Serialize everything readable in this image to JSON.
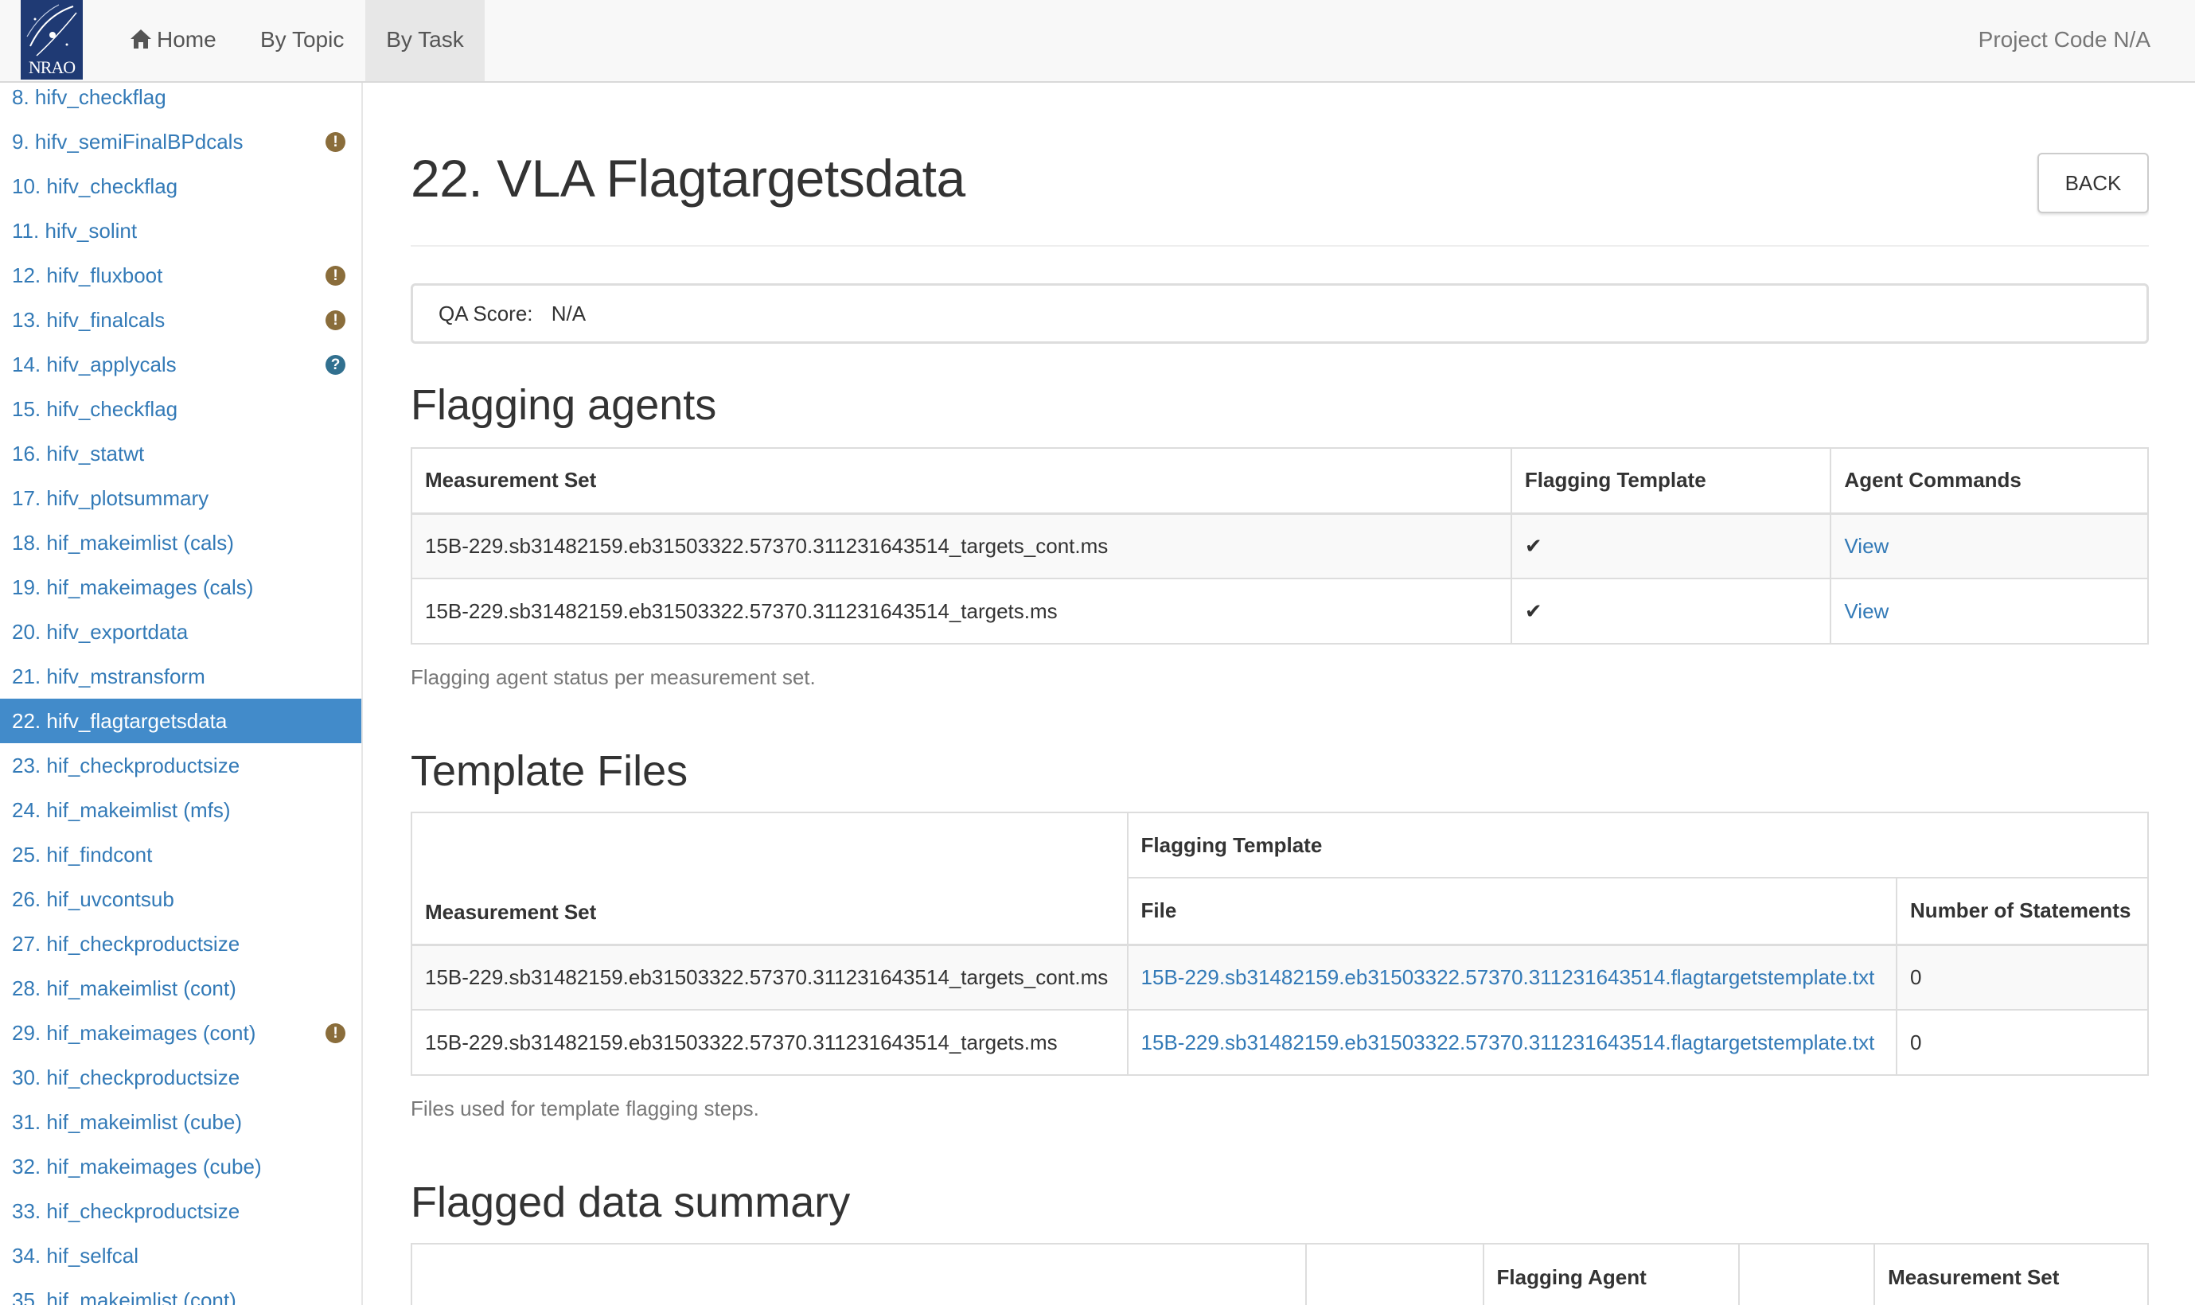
{
  "navbar": {
    "logo_text": "NRAO",
    "home_label": "Home",
    "by_topic_label": "By Topic",
    "by_task_label": "By Task",
    "project_code": "Project Code N/A"
  },
  "sidebar": {
    "items": [
      {
        "label": "8. hifv_checkflag",
        "qa": ""
      },
      {
        "label": "9. hifv_semiFinalBPdcals",
        "qa": "warning"
      },
      {
        "label": "10. hifv_checkflag",
        "qa": ""
      },
      {
        "label": "11. hifv_solint",
        "qa": ""
      },
      {
        "label": "12. hifv_fluxboot",
        "qa": "warning"
      },
      {
        "label": "13. hifv_finalcals",
        "qa": "warning"
      },
      {
        "label": "14. hifv_applycals",
        "qa": "info"
      },
      {
        "label": "15. hifv_checkflag",
        "qa": ""
      },
      {
        "label": "16. hifv_statwt",
        "qa": ""
      },
      {
        "label": "17. hifv_plotsummary",
        "qa": ""
      },
      {
        "label": "18. hif_makeimlist (cals)",
        "qa": ""
      },
      {
        "label": "19. hif_makeimages (cals)",
        "qa": ""
      },
      {
        "label": "20. hifv_exportdata",
        "qa": ""
      },
      {
        "label": "21. hifv_mstransform",
        "qa": ""
      },
      {
        "label": "22. hifv_flagtargetsdata",
        "qa": "",
        "active": true
      },
      {
        "label": "23. hif_checkproductsize",
        "qa": ""
      },
      {
        "label": "24. hif_makeimlist (mfs)",
        "qa": ""
      },
      {
        "label": "25. hif_findcont",
        "qa": ""
      },
      {
        "label": "26. hif_uvcontsub",
        "qa": ""
      },
      {
        "label": "27. hif_checkproductsize",
        "qa": ""
      },
      {
        "label": "28. hif_makeimlist (cont)",
        "qa": ""
      },
      {
        "label": "29. hif_makeimages (cont)",
        "qa": "warning"
      },
      {
        "label": "30. hif_checkproductsize",
        "qa": ""
      },
      {
        "label": "31. hif_makeimlist (cube)",
        "qa": ""
      },
      {
        "label": "32. hif_makeimages (cube)",
        "qa": ""
      },
      {
        "label": "33. hif_checkproductsize",
        "qa": ""
      },
      {
        "label": "34. hif_selfcal",
        "qa": ""
      },
      {
        "label": "35. hif_makeimlist (cont)",
        "qa": ""
      }
    ]
  },
  "main": {
    "title": "22. VLA Flagtargetsdata",
    "back_label": "BACK",
    "qa_score_label": "QA Score:",
    "qa_score_value": "N/A",
    "flagging_agents": {
      "heading": "Flagging agents",
      "columns": [
        "Measurement Set",
        "Flagging Template",
        "Agent Commands"
      ],
      "rows": [
        {
          "ms": "15B-229.sb31482159.eb31503322.57370.311231643514_targets_cont.ms",
          "template": "✔",
          "commands": "View"
        },
        {
          "ms": "15B-229.sb31482159.eb31503322.57370.311231643514_targets.ms",
          "template": "✔",
          "commands": "View"
        }
      ],
      "caption": "Flagging agent status per measurement set."
    },
    "template_files": {
      "heading": "Template Files",
      "group_header": "Flagging Template",
      "columns": [
        "Measurement Set",
        "File",
        "Number of Statements"
      ],
      "rows": [
        {
          "ms": "15B-229.sb31482159.eb31503322.57370.311231643514_targets_cont.ms",
          "file": "15B-229.sb31482159.eb31503322.57370.311231643514.flagtargetstemplate.txt",
          "statements": "0"
        },
        {
          "ms": "15B-229.sb31482159.eb31503322.57370.311231643514_targets.ms",
          "file": "15B-229.sb31482159.eb31503322.57370.311231643514.flagtargetstemplate.txt",
          "statements": "0"
        }
      ],
      "caption": "Files used for template flagging steps."
    },
    "flagged_summary": {
      "heading": "Flagged data summary",
      "group_headers": [
        "Flagging Agent",
        "Measurement Set"
      ]
    }
  },
  "colors": {
    "link": "#337ab7",
    "active_bg": "#428bca",
    "qa_warning": "#8a6d3b",
    "qa_info": "#31708f"
  }
}
